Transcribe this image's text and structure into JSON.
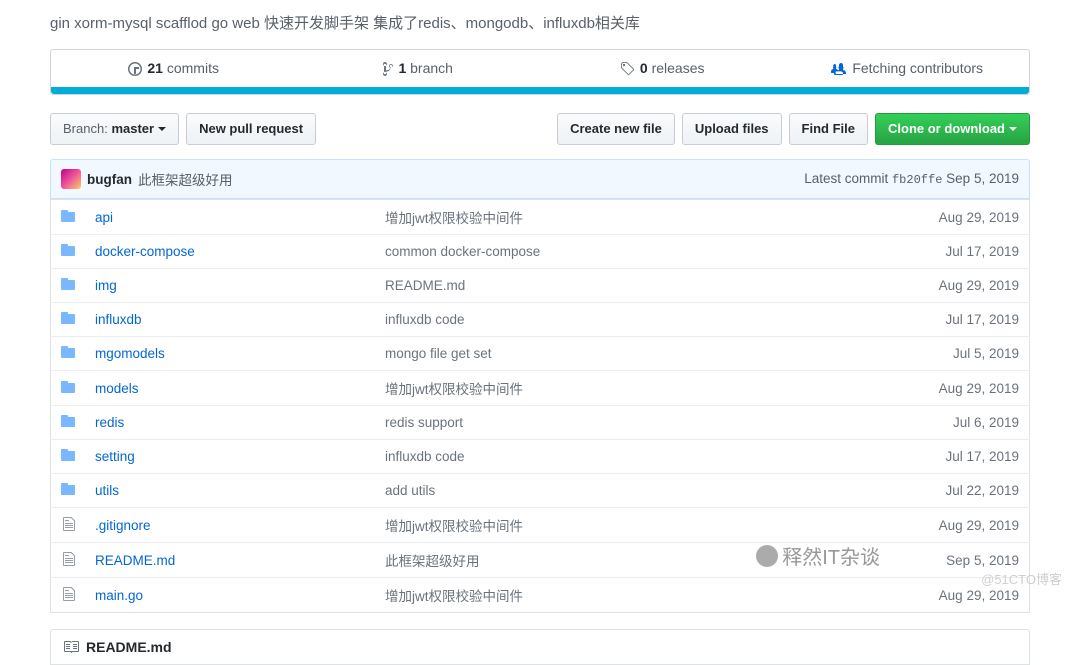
{
  "description": "gin xorm-mysql scafflod go web 快速开发脚手架 集成了redis、mongodb、influxdb相关库",
  "stats": {
    "commits_count": "21",
    "commits_label": "commits",
    "branches_count": "1",
    "branches_label": "branch",
    "releases_count": "0",
    "releases_label": "releases",
    "contributors_label": "Fetching contributors"
  },
  "toolbar": {
    "branch_label": "Branch:",
    "branch_value": "master",
    "new_pr_label": "New pull request",
    "create_file_label": "Create new file",
    "upload_label": "Upload files",
    "find_label": "Find File",
    "clone_label": "Clone or download"
  },
  "latest_commit": {
    "user": "bugfan",
    "message": "此框架超级好用",
    "right_prefix": "Latest commit",
    "sha": "fb20ffe",
    "date": "Sep 5, 2019"
  },
  "files": [
    {
      "type": "dir",
      "name": "api",
      "msg": "增加jwt权限校验中间件",
      "date": "Aug 29, 2019"
    },
    {
      "type": "dir",
      "name": "docker-compose",
      "msg": "common docker-compose",
      "date": "Jul 17, 2019"
    },
    {
      "type": "dir",
      "name": "img",
      "msg": "README.md",
      "date": "Aug 29, 2019"
    },
    {
      "type": "dir",
      "name": "influxdb",
      "msg": "influxdb code",
      "date": "Jul 17, 2019"
    },
    {
      "type": "dir",
      "name": "mgomodels",
      "msg": "mongo file get set",
      "date": "Jul 5, 2019"
    },
    {
      "type": "dir",
      "name": "models",
      "msg": "增加jwt权限校验中间件",
      "date": "Aug 29, 2019"
    },
    {
      "type": "dir",
      "name": "redis",
      "msg": "redis support",
      "date": "Jul 6, 2019"
    },
    {
      "type": "dir",
      "name": "setting",
      "msg": "influxdb code",
      "date": "Jul 17, 2019"
    },
    {
      "type": "dir",
      "name": "utils",
      "msg": "add utils",
      "date": "Jul 22, 2019"
    },
    {
      "type": "file",
      "name": ".gitignore",
      "msg": "增加jwt权限校验中间件",
      "date": "Aug 29, 2019"
    },
    {
      "type": "file",
      "name": "README.md",
      "msg": "此框架超级好用",
      "date": "Sep 5, 2019"
    },
    {
      "type": "file",
      "name": "main.go",
      "msg": "增加jwt权限校验中间件",
      "date": "Aug 29, 2019"
    }
  ],
  "readme_header": "README.md",
  "watermark": {
    "footer": "@51CTO博客",
    "qr": "释然IT杂谈"
  }
}
